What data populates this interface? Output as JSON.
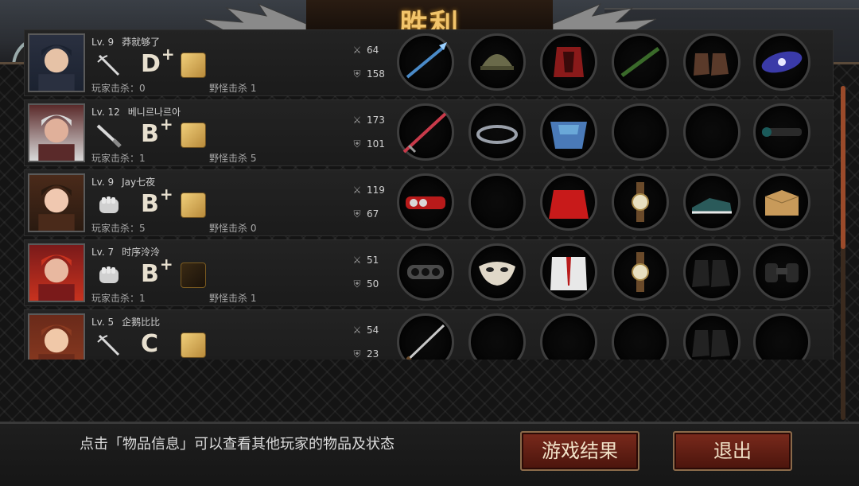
{
  "title": "胜利",
  "hint_text": "点击「物品信息」可以查看其他玩家的物品及状态",
  "buttons": {
    "results": "游戏结果",
    "exit": "退出"
  },
  "colors": {
    "accent_gold": "#f2c46a",
    "button_red": "#7a2a1c",
    "scroll_thumb": "#9a4a2a"
  },
  "players": [
    {
      "level": "Lv. 9",
      "name": "莽就够了",
      "weapon_icon": "sword-icon",
      "grade": "D",
      "grade_plus": "+",
      "player_kills": "玩家击杀：0",
      "monster_kills": "野怪击杀 1",
      "attack": "64",
      "defense": "158",
      "equipment": [
        "ice-spear-icon",
        "helmet-icon",
        "red-armor-icon",
        "stick-icon",
        "boots-icon",
        "galaxy-icon"
      ]
    },
    {
      "level": "Lv. 12",
      "name": "베니르나르아",
      "weapon_icon": "knife-icon",
      "grade": "B",
      "grade_plus": "+",
      "player_kills": "玩家击杀：1",
      "monster_kills": "野怪击杀 5",
      "attack": "173",
      "defense": "101",
      "equipment": [
        "red-sword-icon",
        "ring-band-icon",
        "blue-garment-icon",
        "empty",
        "empty",
        "scope-icon"
      ]
    },
    {
      "level": "Lv. 9",
      "name": "Jay七夜",
      "weapon_icon": "fist-icon",
      "grade": "B",
      "grade_plus": "+",
      "player_kills": "玩家击杀：5",
      "monster_kills": "野怪击杀 0",
      "attack": "119",
      "defense": "67",
      "equipment": [
        "red-knuckle-icon",
        "empty",
        "red-dress-icon",
        "watch-icon",
        "sneakers-icon",
        "box-icon"
      ]
    },
    {
      "level": "Lv. 7",
      "name": "时序泠泠",
      "weapon_icon": "fist-icon",
      "grade": "B",
      "grade_plus": "+",
      "player_kills": "玩家击杀：1",
      "monster_kills": "野怪击杀 1",
      "attack": "51",
      "defense": "50",
      "equipment": [
        "brass-knuckle-icon",
        "mask-icon",
        "white-suit-icon",
        "watch-icon",
        "black-boots-icon",
        "binoculars-icon"
      ]
    },
    {
      "level": "Lv. 5",
      "name": "企鹅比比",
      "weapon_icon": "sword-icon",
      "grade": "C",
      "grade_plus": "",
      "player_kills": "",
      "monster_kills": "",
      "attack": "54",
      "defense": "23",
      "equipment": [
        "katana-icon",
        "empty",
        "empty",
        "empty",
        "black-boots-icon",
        "empty"
      ]
    }
  ]
}
